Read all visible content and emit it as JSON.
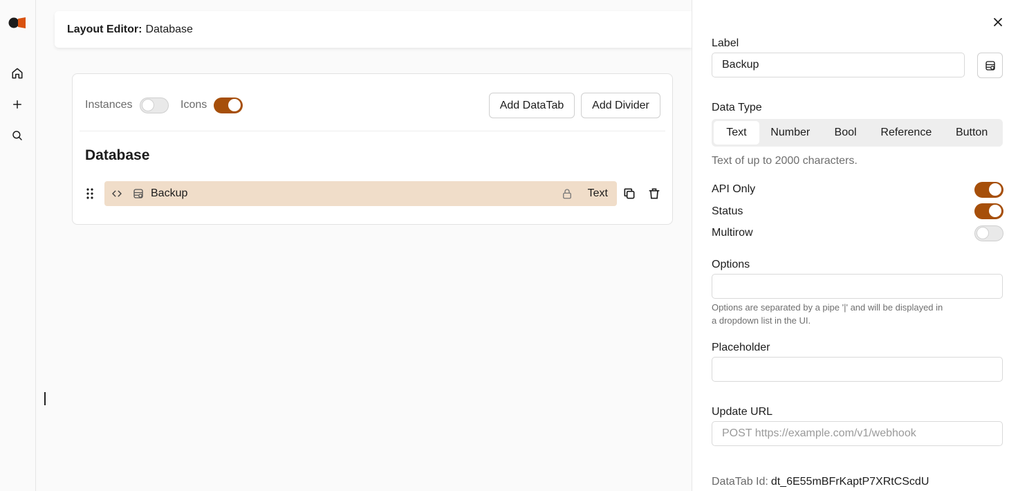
{
  "header": {
    "title_prefix": "Layout Editor:",
    "title_name": "Database"
  },
  "rail": {
    "icons": [
      "logo-icon",
      "home-icon",
      "plus-icon",
      "search-icon"
    ]
  },
  "toolbar": {
    "instances_label": "Instances",
    "instances_on": false,
    "icons_label": "Icons",
    "icons_on": true,
    "add_datatab_label": "Add DataTab",
    "add_divider_label": "Add Divider"
  },
  "section": {
    "title": "Database"
  },
  "row": {
    "label": "Backup",
    "type": "Text"
  },
  "panel": {
    "label_title": "Label",
    "label_value": "Backup",
    "data_type_title": "Data Type",
    "data_types": [
      "Text",
      "Number",
      "Bool",
      "Reference",
      "Button"
    ],
    "data_type_selected": "Text",
    "data_type_hint": "Text of up to 2000 characters.",
    "api_only_label": "API Only",
    "api_only_on": true,
    "status_label": "Status",
    "status_on": true,
    "multirow_label": "Multirow",
    "multirow_on": false,
    "options_title": "Options",
    "options_value": "",
    "options_hint_1": "Options are separated by a pipe '|' and will be displayed in",
    "options_hint_2": "a dropdown list in the UI.",
    "placeholder_title": "Placeholder",
    "placeholder_value": "",
    "update_url_title": "Update URL",
    "update_url_placeholder": "POST https://example.com/v1/webhook",
    "datatab_id_label": "DataTab Id:",
    "datatab_id_value": "dt_6E55mBFrKaptP7XRtCScdU"
  },
  "colors": {
    "accent": "#a64f0a",
    "row_highlight": "#f0ddc9",
    "logo_orange": "#d9520f"
  }
}
